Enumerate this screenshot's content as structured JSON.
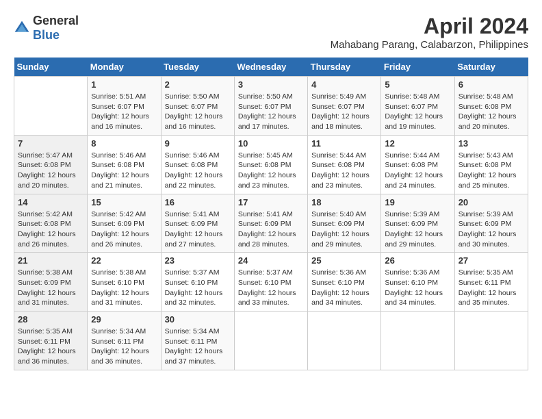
{
  "logo": {
    "general": "General",
    "blue": "Blue"
  },
  "header": {
    "month": "April 2024",
    "location": "Mahabang Parang, Calabarzon, Philippines"
  },
  "weekdays": [
    "Sunday",
    "Monday",
    "Tuesday",
    "Wednesday",
    "Thursday",
    "Friday",
    "Saturday"
  ],
  "weeks": [
    [
      {
        "day": "",
        "sunrise": "",
        "sunset": "",
        "daylight": ""
      },
      {
        "day": "1",
        "sunrise": "Sunrise: 5:51 AM",
        "sunset": "Sunset: 6:07 PM",
        "daylight": "Daylight: 12 hours and 16 minutes."
      },
      {
        "day": "2",
        "sunrise": "Sunrise: 5:50 AM",
        "sunset": "Sunset: 6:07 PM",
        "daylight": "Daylight: 12 hours and 16 minutes."
      },
      {
        "day": "3",
        "sunrise": "Sunrise: 5:50 AM",
        "sunset": "Sunset: 6:07 PM",
        "daylight": "Daylight: 12 hours and 17 minutes."
      },
      {
        "day": "4",
        "sunrise": "Sunrise: 5:49 AM",
        "sunset": "Sunset: 6:07 PM",
        "daylight": "Daylight: 12 hours and 18 minutes."
      },
      {
        "day": "5",
        "sunrise": "Sunrise: 5:48 AM",
        "sunset": "Sunset: 6:07 PM",
        "daylight": "Daylight: 12 hours and 19 minutes."
      },
      {
        "day": "6",
        "sunrise": "Sunrise: 5:48 AM",
        "sunset": "Sunset: 6:08 PM",
        "daylight": "Daylight: 12 hours and 20 minutes."
      }
    ],
    [
      {
        "day": "7",
        "sunrise": "Sunrise: 5:47 AM",
        "sunset": "Sunset: 6:08 PM",
        "daylight": "Daylight: 12 hours and 20 minutes."
      },
      {
        "day": "8",
        "sunrise": "Sunrise: 5:46 AM",
        "sunset": "Sunset: 6:08 PM",
        "daylight": "Daylight: 12 hours and 21 minutes."
      },
      {
        "day": "9",
        "sunrise": "Sunrise: 5:46 AM",
        "sunset": "Sunset: 6:08 PM",
        "daylight": "Daylight: 12 hours and 22 minutes."
      },
      {
        "day": "10",
        "sunrise": "Sunrise: 5:45 AM",
        "sunset": "Sunset: 6:08 PM",
        "daylight": "Daylight: 12 hours and 23 minutes."
      },
      {
        "day": "11",
        "sunrise": "Sunrise: 5:44 AM",
        "sunset": "Sunset: 6:08 PM",
        "daylight": "Daylight: 12 hours and 23 minutes."
      },
      {
        "day": "12",
        "sunrise": "Sunrise: 5:44 AM",
        "sunset": "Sunset: 6:08 PM",
        "daylight": "Daylight: 12 hours and 24 minutes."
      },
      {
        "day": "13",
        "sunrise": "Sunrise: 5:43 AM",
        "sunset": "Sunset: 6:08 PM",
        "daylight": "Daylight: 12 hours and 25 minutes."
      }
    ],
    [
      {
        "day": "14",
        "sunrise": "Sunrise: 5:42 AM",
        "sunset": "Sunset: 6:08 PM",
        "daylight": "Daylight: 12 hours and 26 minutes."
      },
      {
        "day": "15",
        "sunrise": "Sunrise: 5:42 AM",
        "sunset": "Sunset: 6:09 PM",
        "daylight": "Daylight: 12 hours and 26 minutes."
      },
      {
        "day": "16",
        "sunrise": "Sunrise: 5:41 AM",
        "sunset": "Sunset: 6:09 PM",
        "daylight": "Daylight: 12 hours and 27 minutes."
      },
      {
        "day": "17",
        "sunrise": "Sunrise: 5:41 AM",
        "sunset": "Sunset: 6:09 PM",
        "daylight": "Daylight: 12 hours and 28 minutes."
      },
      {
        "day": "18",
        "sunrise": "Sunrise: 5:40 AM",
        "sunset": "Sunset: 6:09 PM",
        "daylight": "Daylight: 12 hours and 29 minutes."
      },
      {
        "day": "19",
        "sunrise": "Sunrise: 5:39 AM",
        "sunset": "Sunset: 6:09 PM",
        "daylight": "Daylight: 12 hours and 29 minutes."
      },
      {
        "day": "20",
        "sunrise": "Sunrise: 5:39 AM",
        "sunset": "Sunset: 6:09 PM",
        "daylight": "Daylight: 12 hours and 30 minutes."
      }
    ],
    [
      {
        "day": "21",
        "sunrise": "Sunrise: 5:38 AM",
        "sunset": "Sunset: 6:09 PM",
        "daylight": "Daylight: 12 hours and 31 minutes."
      },
      {
        "day": "22",
        "sunrise": "Sunrise: 5:38 AM",
        "sunset": "Sunset: 6:10 PM",
        "daylight": "Daylight: 12 hours and 31 minutes."
      },
      {
        "day": "23",
        "sunrise": "Sunrise: 5:37 AM",
        "sunset": "Sunset: 6:10 PM",
        "daylight": "Daylight: 12 hours and 32 minutes."
      },
      {
        "day": "24",
        "sunrise": "Sunrise: 5:37 AM",
        "sunset": "Sunset: 6:10 PM",
        "daylight": "Daylight: 12 hours and 33 minutes."
      },
      {
        "day": "25",
        "sunrise": "Sunrise: 5:36 AM",
        "sunset": "Sunset: 6:10 PM",
        "daylight": "Daylight: 12 hours and 34 minutes."
      },
      {
        "day": "26",
        "sunrise": "Sunrise: 5:36 AM",
        "sunset": "Sunset: 6:10 PM",
        "daylight": "Daylight: 12 hours and 34 minutes."
      },
      {
        "day": "27",
        "sunrise": "Sunrise: 5:35 AM",
        "sunset": "Sunset: 6:11 PM",
        "daylight": "Daylight: 12 hours and 35 minutes."
      }
    ],
    [
      {
        "day": "28",
        "sunrise": "Sunrise: 5:35 AM",
        "sunset": "Sunset: 6:11 PM",
        "daylight": "Daylight: 12 hours and 36 minutes."
      },
      {
        "day": "29",
        "sunrise": "Sunrise: 5:34 AM",
        "sunset": "Sunset: 6:11 PM",
        "daylight": "Daylight: 12 hours and 36 minutes."
      },
      {
        "day": "30",
        "sunrise": "Sunrise: 5:34 AM",
        "sunset": "Sunset: 6:11 PM",
        "daylight": "Daylight: 12 hours and 37 minutes."
      },
      {
        "day": "",
        "sunrise": "",
        "sunset": "",
        "daylight": ""
      },
      {
        "day": "",
        "sunrise": "",
        "sunset": "",
        "daylight": ""
      },
      {
        "day": "",
        "sunrise": "",
        "sunset": "",
        "daylight": ""
      },
      {
        "day": "",
        "sunrise": "",
        "sunset": "",
        "daylight": ""
      }
    ]
  ]
}
